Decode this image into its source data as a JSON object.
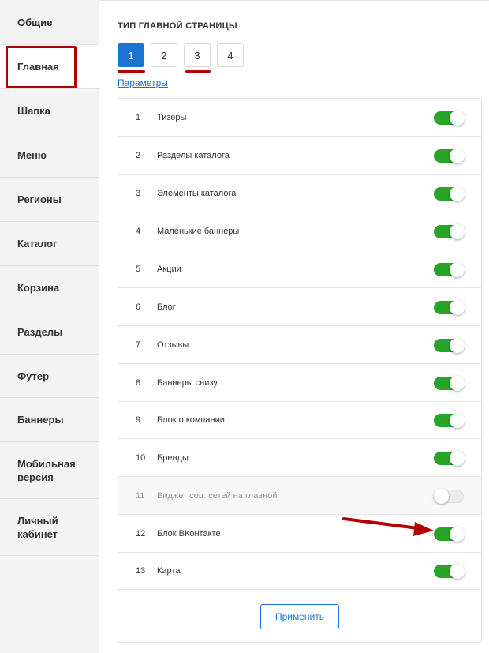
{
  "sidebar": {
    "items": [
      {
        "label": "Общие"
      },
      {
        "label": "Главная"
      },
      {
        "label": "Шапка"
      },
      {
        "label": "Меню"
      },
      {
        "label": "Регионы"
      },
      {
        "label": "Каталог"
      },
      {
        "label": "Корзина"
      },
      {
        "label": "Разделы"
      },
      {
        "label": "Футер"
      },
      {
        "label": "Баннеры"
      },
      {
        "label": "Мобильная версия"
      },
      {
        "label": "Личный кабинет"
      }
    ],
    "active": "Главная"
  },
  "main": {
    "section_title": "ТИП ГЛАВНОЙ СТРАНИЦЫ",
    "types": [
      {
        "label": "1",
        "selected": true
      },
      {
        "label": "2",
        "selected": false
      },
      {
        "label": "3",
        "selected": false
      },
      {
        "label": "4",
        "selected": false
      }
    ],
    "params_link": "Параметры",
    "blocks": [
      {
        "num": "1",
        "label": "Тизеры",
        "enabled": true
      },
      {
        "num": "2",
        "label": "Разделы каталога",
        "enabled": true
      },
      {
        "num": "3",
        "label": "Элементы каталога",
        "enabled": true
      },
      {
        "num": "4",
        "label": "Маленькие баннеры",
        "enabled": true
      },
      {
        "num": "5",
        "label": "Акции",
        "enabled": true
      },
      {
        "num": "6",
        "label": "Блог",
        "enabled": true
      },
      {
        "num": "7",
        "label": "Отзывы",
        "enabled": true
      },
      {
        "num": "8",
        "label": "Баннеры снизу",
        "enabled": true
      },
      {
        "num": "9",
        "label": "Блок о компании",
        "enabled": true
      },
      {
        "num": "10",
        "label": "Бренды",
        "enabled": true
      },
      {
        "num": "11",
        "label": "Виджет соц. сетей на главной",
        "enabled": false
      },
      {
        "num": "12",
        "label": "Блок ВКонтакте",
        "enabled": true
      },
      {
        "num": "13",
        "label": "Карта",
        "enabled": true
      }
    ],
    "apply_label": "Применить"
  },
  "colors": {
    "accent": "#1b74d2",
    "toggle_on": "#28a428",
    "annotation": "#b30000"
  }
}
